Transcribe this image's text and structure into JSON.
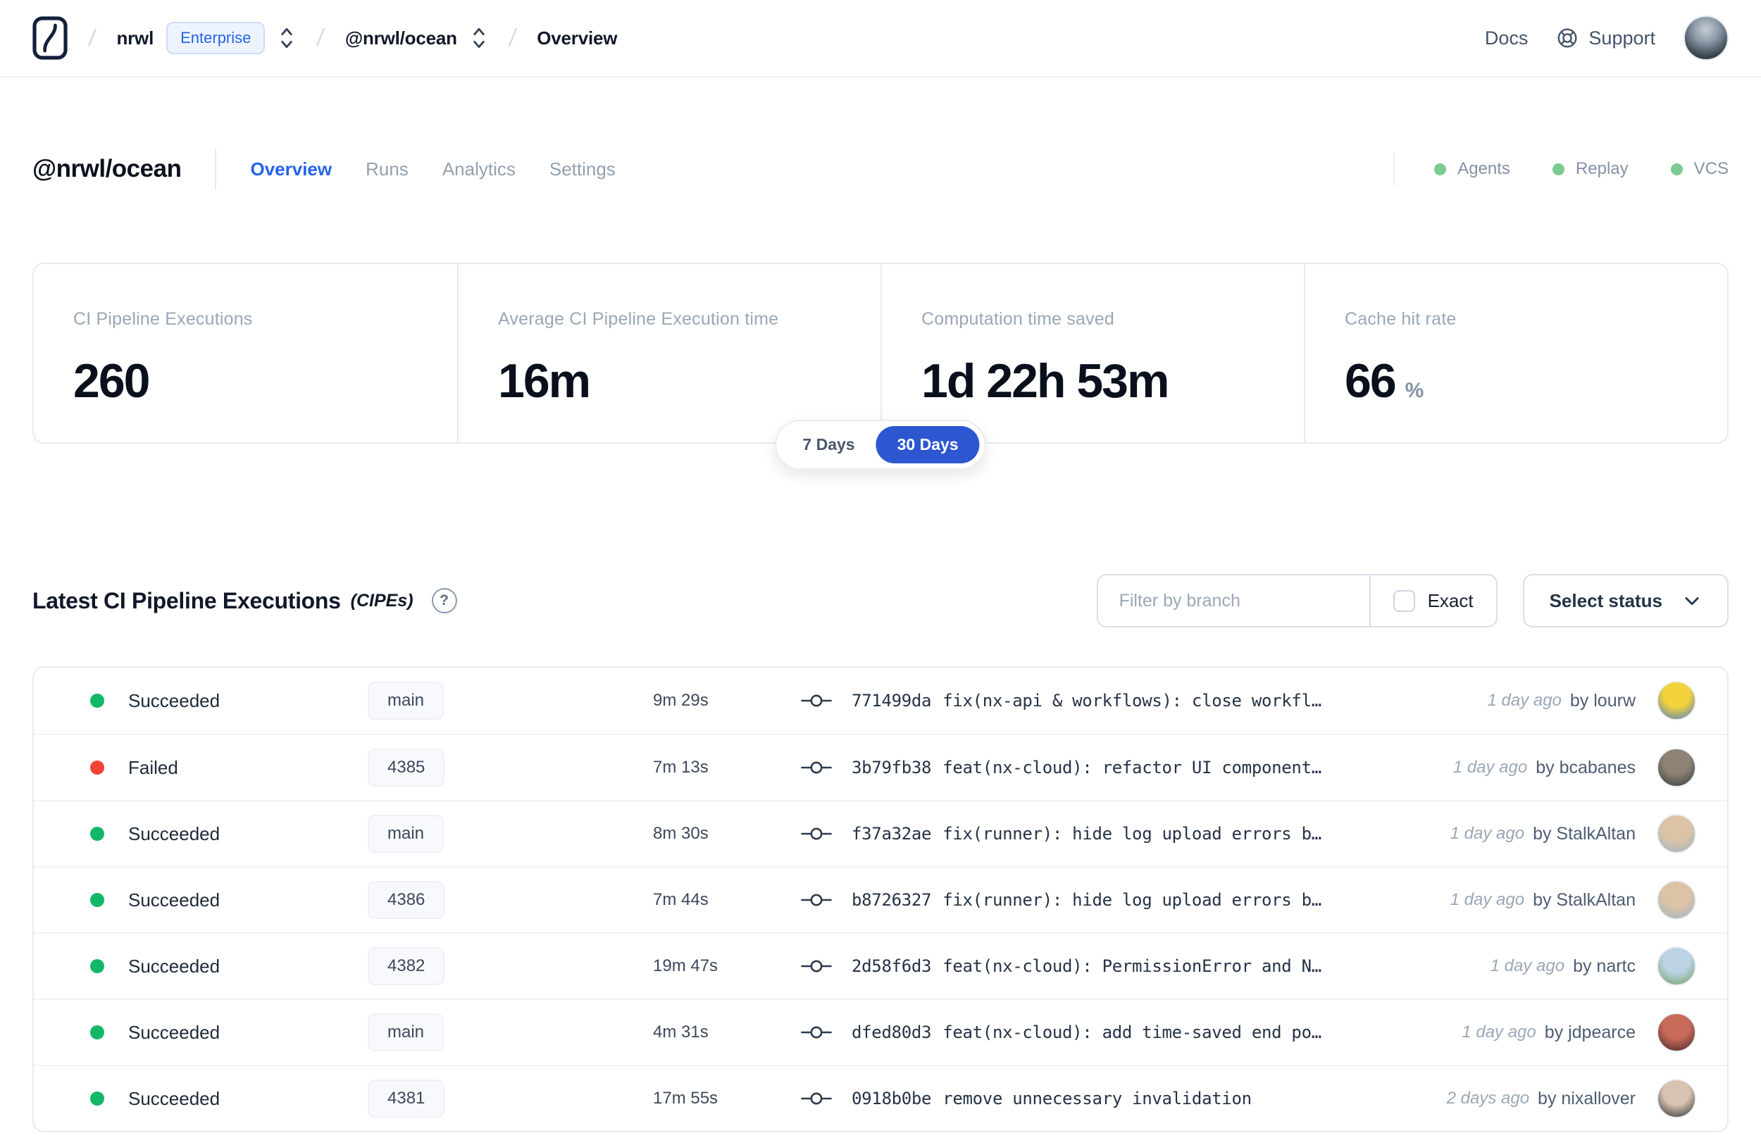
{
  "colors": {
    "accent_blue": "#2563eb",
    "toggle_active_blue": "#2d57d0",
    "success_green": "#12b76a",
    "failed_red": "#f04438",
    "feature_ok_green": "#7ccb92"
  },
  "navbar": {
    "org": "nrwl",
    "plan_badge": "Enterprise",
    "workspace": "@nrwl/ocean",
    "page": "Overview",
    "docs_label": "Docs",
    "support_label": "Support"
  },
  "header": {
    "title": "@nrwl/ocean",
    "tabs": [
      {
        "label": "Overview",
        "active": true
      },
      {
        "label": "Runs",
        "active": false
      },
      {
        "label": "Analytics",
        "active": false
      },
      {
        "label": "Settings",
        "active": false
      }
    ],
    "features": [
      {
        "label": "Agents"
      },
      {
        "label": "Replay"
      },
      {
        "label": "VCS"
      }
    ]
  },
  "stats": {
    "cards": [
      {
        "label": "CI Pipeline Executions",
        "value": "260"
      },
      {
        "label": "Average CI Pipeline Execution time",
        "value": "16m"
      },
      {
        "label": "Computation time saved",
        "value": "1d 22h 53m"
      },
      {
        "label": "Cache hit rate",
        "value": "66",
        "suffix": "%"
      }
    ],
    "range_toggle": {
      "options": [
        "7 Days",
        "30 Days"
      ],
      "selected": "30 Days"
    }
  },
  "cipes": {
    "title": "Latest CI Pipeline Executions",
    "title_suffix": "(CIPEs)",
    "filter": {
      "placeholder": "Filter by branch",
      "exact_label": "Exact",
      "status_label": "Select status"
    },
    "rows": [
      {
        "status": "Succeeded",
        "status_color": "#12b76a",
        "branch": "main",
        "duration": "9m 29s",
        "commit_hash": "771499da",
        "commit_message": "fix(nx-api & workflows): close workfl…",
        "time_ago": "1 day ago",
        "author": "by lourw",
        "avatar_colors": [
          "#f2d33c",
          "#4a7bc8"
        ]
      },
      {
        "status": "Failed",
        "status_color": "#f04438",
        "branch": "4385",
        "duration": "7m 13s",
        "commit_hash": "3b79fb38",
        "commit_message": "feat(nx-cloud): refactor UI component…",
        "time_ago": "1 day ago",
        "author": "by bcabanes",
        "avatar_colors": [
          "#8d8274",
          "#33393f"
        ]
      },
      {
        "status": "Succeeded",
        "status_color": "#12b76a",
        "branch": "main",
        "duration": "8m 30s",
        "commit_hash": "f37a32ae",
        "commit_message": "fix(runner): hide log upload errors b…",
        "time_ago": "1 day ago",
        "author": "by StalkAltan",
        "avatar_colors": [
          "#ddc3a6",
          "#9fb6c4"
        ]
      },
      {
        "status": "Succeeded",
        "status_color": "#12b76a",
        "branch": "4386",
        "duration": "7m 44s",
        "commit_hash": "b8726327",
        "commit_message": "fix(runner): hide log upload errors b…",
        "time_ago": "1 day ago",
        "author": "by StalkAltan",
        "avatar_colors": [
          "#ddc3a6",
          "#9fb6c4"
        ]
      },
      {
        "status": "Succeeded",
        "status_color": "#12b76a",
        "branch": "4382",
        "duration": "19m 47s",
        "commit_hash": "2d58f6d3",
        "commit_message": "feat(nx-cloud): PermissionError and N…",
        "time_ago": "1 day ago",
        "author": "by nartc",
        "avatar_colors": [
          "#bcd3e6",
          "#6e9e5d"
        ]
      },
      {
        "status": "Succeeded",
        "status_color": "#12b76a",
        "branch": "main",
        "duration": "4m 31s",
        "commit_hash": "dfed80d3",
        "commit_message": "feat(nx-cloud): add time-saved end po…",
        "time_ago": "1 day ago",
        "author": "by jdpearce",
        "avatar_colors": [
          "#c76a5a",
          "#45232a"
        ]
      },
      {
        "status": "Succeeded",
        "status_color": "#12b76a",
        "branch": "4381",
        "duration": "17m 55s",
        "commit_hash": "0918b0be",
        "commit_message": "remove unnecessary invalidation",
        "time_ago": "2 days ago",
        "author": "by nixallover",
        "avatar_colors": [
          "#d8c3b0",
          "#2b2b30"
        ]
      }
    ]
  }
}
